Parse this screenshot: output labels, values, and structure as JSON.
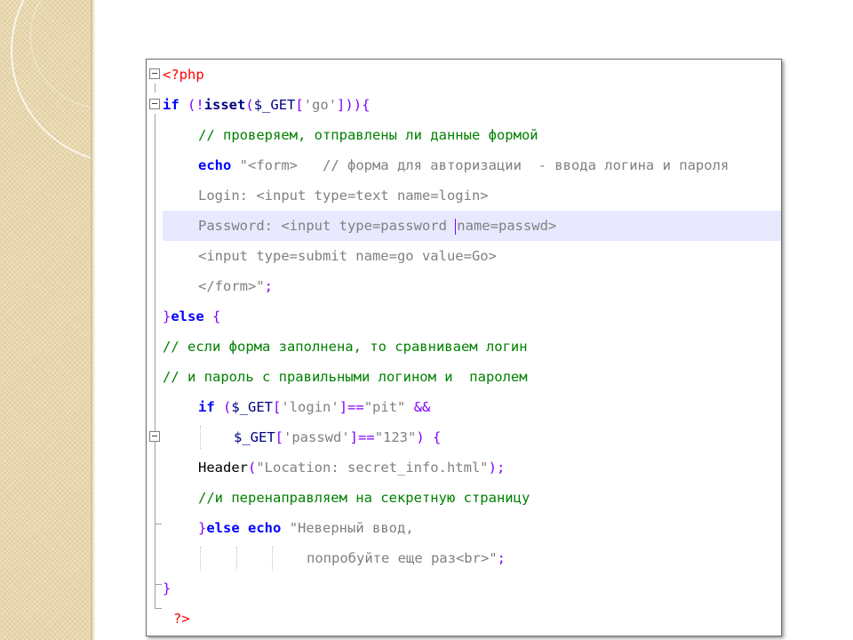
{
  "editor": {
    "lines": [
      {
        "t": [
          "<?php"
        ]
      },
      {
        "t": [
          "if",
          " (",
          "!",
          "isset",
          "(",
          "$_GET",
          "[",
          "'go'",
          "]",
          "))",
          "{"
        ]
      },
      {
        "t": [
          "// проверяем, отправлены ли данные формой"
        ]
      },
      {
        "t": [
          "echo",
          " ",
          "\"<form>   // форма для авторизации  - ввода логина и пароля"
        ]
      },
      {
        "t": [
          "Login: <input type=text name=login>"
        ]
      },
      {
        "t": [
          "Password: <input type=password ",
          "name=passwd>"
        ]
      },
      {
        "t": [
          "<input type=submit name=go value=Go>"
        ]
      },
      {
        "t": [
          "</form>\"",
          ";"
        ]
      },
      {
        "t": [
          "}",
          "else",
          " {"
        ]
      },
      {
        "t": [
          "// если форма заполнена, то сравниваем логин"
        ]
      },
      {
        "t": [
          "// и пароль с правильными логином и  паролем"
        ]
      },
      {
        "t": [
          "if",
          " (",
          "$_GET",
          "[",
          "'login'",
          "]",
          "==",
          "\"pit\"",
          " &&"
        ]
      },
      {
        "t": [
          "$_GET",
          "[",
          "'passwd'",
          "]",
          "==",
          "\"123\"",
          ") {"
        ]
      },
      {
        "t": [
          "Header",
          "(",
          "\"Location: secret_info.html\"",
          ");"
        ]
      },
      {
        "t": [
          "//и перенаправляем на секретную страницу"
        ]
      },
      {
        "t": [
          "}",
          "else",
          " ",
          "echo",
          " ",
          "\"Неверный ввод,"
        ]
      },
      {
        "t": [
          "попробуйте еще раз<br>\"",
          ";"
        ]
      },
      {
        "t": [
          "}"
        ]
      },
      {
        "t": [
          "?>"
        ]
      }
    ]
  }
}
